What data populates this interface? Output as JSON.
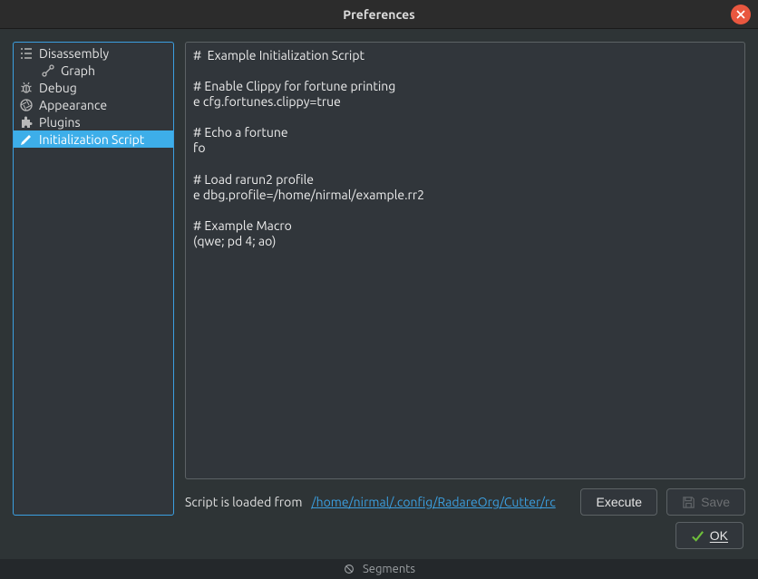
{
  "window": {
    "title": "Preferences"
  },
  "sidebar": {
    "items": [
      {
        "label": "Disassembly"
      },
      {
        "label": "Graph"
      },
      {
        "label": "Debug"
      },
      {
        "label": "Appearance"
      },
      {
        "label": "Plugins"
      },
      {
        "label": "Initialization Script"
      }
    ]
  },
  "editor": {
    "content": "#  Example Initialization Script\n\n# Enable Clippy for fortune printing\ne cfg.fortunes.clippy=true\n\n# Echo a fortune\nfo\n\n# Load rarun2 profile\ne dbg.profile=/home/nirmal/example.rr2\n\n# Example Macro\n(qwe; pd 4; ao)"
  },
  "script_info": {
    "label": "Script is loaded from ",
    "path": "/home/nirmal/.config/RadareOrg/Cutter/rc"
  },
  "buttons": {
    "execute": "Execute",
    "save": "Save",
    "ok": "OK"
  },
  "statusbar": {
    "text": "Segments"
  }
}
